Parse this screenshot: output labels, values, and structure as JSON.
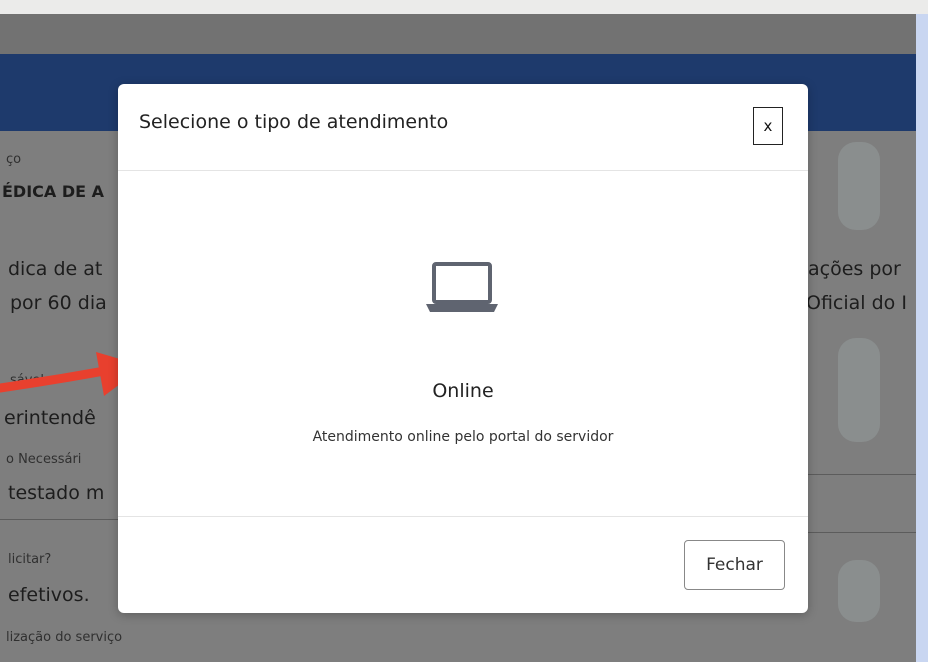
{
  "background_page": {
    "service_label_fragment": "ço",
    "service_title_fragment": "ÉDICA DE A",
    "description_left_line1": "dica de at",
    "description_left_line2": "por 60 dia",
    "description_right_line1": "ações por",
    "description_right_line2": "Oficial do I",
    "responsible_label_fragment": "sável",
    "responsible_value_fragment": "erintendê",
    "required_label_fragment": "o Necessári",
    "required_value_fragment": "testado m",
    "who_label_fragment": "licitar?",
    "who_value_fragment": "efetivos.",
    "location_label_fragment": "lização do serviço"
  },
  "modal": {
    "title": "Selecione o tipo de atendimento",
    "close_label": "x",
    "option": {
      "icon": "laptop-icon",
      "title": "Online",
      "description": "Atendimento online pelo portal do servidor"
    },
    "footer_button": "Fechar"
  },
  "colors": {
    "header_band": "#1e3a6c",
    "annotation_arrow": "#e8402e",
    "icon": "#5f6470"
  }
}
